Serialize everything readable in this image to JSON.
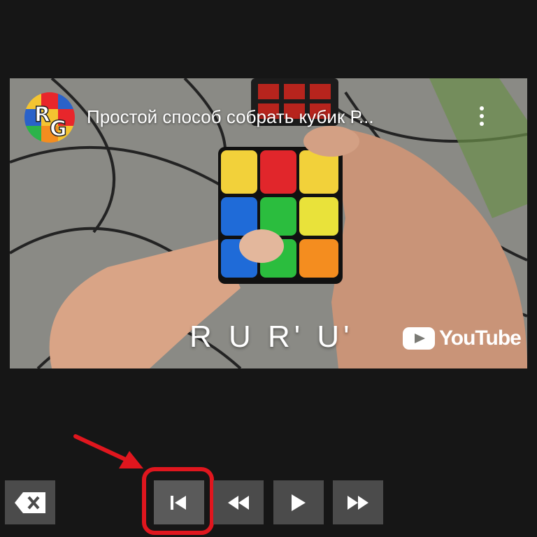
{
  "video": {
    "title": "Простой способ собрать кубик Р...",
    "channel_logo_text": "RG",
    "caption": "R U R' U'",
    "brand": "YouTube"
  },
  "controls": {
    "buttons": [
      {
        "name": "delete",
        "icon": "backspace-icon"
      },
      {
        "name": "skip-to-start",
        "icon": "skip-previous-icon",
        "highlighted": true
      },
      {
        "name": "rewind",
        "icon": "rewind-icon"
      },
      {
        "name": "play",
        "icon": "play-icon"
      },
      {
        "name": "fast-forward",
        "icon": "fast-forward-icon"
      }
    ]
  },
  "colors": {
    "background": "#161616",
    "button": "#4b4b4b",
    "highlight": "#e0161e"
  }
}
